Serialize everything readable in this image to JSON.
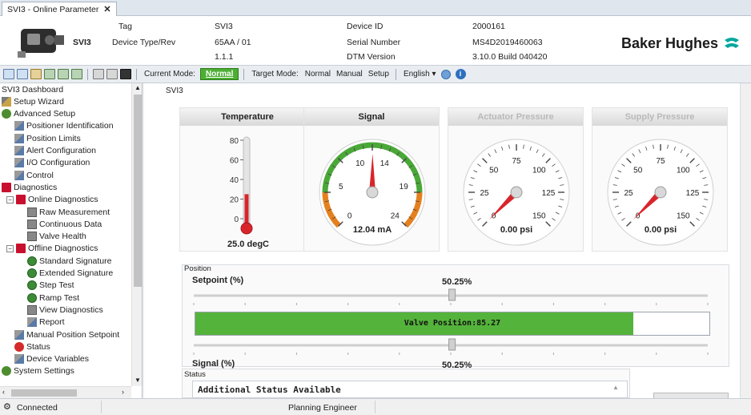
{
  "tab": {
    "label": "SVI3   - Online Parameter",
    "close": "✕"
  },
  "device": {
    "model": "SVI3",
    "tag_label": "Tag",
    "tag_value": "SVI3",
    "type_label": "Device Type/Rev",
    "type_value": "65AA / 01",
    "rev_value": "1.1.1",
    "id_label": "Device ID",
    "id_value": "2000161",
    "serial_label": "Serial Number",
    "serial_value": "MS4D2019460063",
    "dtm_label": "DTM Version",
    "dtm_value": "3.10.0 Build 040420",
    "brand": "Baker Hughes",
    "brand_color": "#00a79d"
  },
  "toolbar": {
    "current_mode_label": "Current Mode:",
    "current_mode_value": "Normal",
    "target_mode_label": "Target Mode:",
    "modes": [
      "Normal",
      "Manual",
      "Setup"
    ],
    "language": "English"
  },
  "tree": {
    "items": [
      {
        "label": "SVI3 Dashboard",
        "icon": "none"
      },
      {
        "label": "Setup Wizard",
        "icon": "wand"
      },
      {
        "label": "Advanced Setup",
        "icon": "gear"
      },
      {
        "label": "Positioner Identification",
        "icon": "pen"
      },
      {
        "label": "Position Limits",
        "icon": "pen"
      },
      {
        "label": "Alert Configuration",
        "icon": "pen"
      },
      {
        "label": "I/O Configuration",
        "icon": "pen"
      },
      {
        "label": "Control",
        "icon": "pen"
      },
      {
        "label": "Diagnostics",
        "icon": "folder"
      },
      {
        "label": "Online Diagnostics",
        "icon": "folder"
      },
      {
        "label": "Raw Measurement",
        "icon": "doc"
      },
      {
        "label": "Continuous Data",
        "icon": "doc"
      },
      {
        "label": "Valve Health",
        "icon": "doc"
      },
      {
        "label": "Offline Diagnostics",
        "icon": "folder"
      },
      {
        "label": "Standard Signature",
        "icon": "green"
      },
      {
        "label": "Extended Signature",
        "icon": "green"
      },
      {
        "label": "Step Test",
        "icon": "green"
      },
      {
        "label": "Ramp Test",
        "icon": "green"
      },
      {
        "label": "View Diagnostics",
        "icon": "doc"
      },
      {
        "label": "Report",
        "icon": "pen"
      },
      {
        "label": "Manual Position Setpoint",
        "icon": "pen"
      },
      {
        "label": "Status",
        "icon": "red"
      },
      {
        "label": "Device Variables",
        "icon": "pen"
      },
      {
        "label": "System Settings",
        "icon": "gear"
      }
    ]
  },
  "main": {
    "panel_label": "SVI3",
    "temperature": {
      "title": "Temperature",
      "value": 25.0,
      "readout": "25.0 degC",
      "ticks": [
        "80",
        "60",
        "40",
        "20",
        "0"
      ],
      "max": 80
    },
    "signal": {
      "title": "Signal",
      "value": 12.04,
      "readout": "12.04 mA",
      "ticks": [
        "0",
        "5",
        "10",
        "14",
        "19",
        "24"
      ],
      "min": 0,
      "max": 24
    },
    "actuator": {
      "title": "Actuator Pressure",
      "value": 0,
      "readout": "0.00 psi",
      "ticks": [
        "0",
        "25",
        "50",
        "75",
        "100",
        "125",
        "150"
      ],
      "max": 150
    },
    "supply": {
      "title": "Supply Pressure",
      "value": 0,
      "readout": "0.00 psi",
      "ticks": [
        "0",
        "25",
        "50",
        "75",
        "100",
        "125",
        "150"
      ],
      "max": 150
    },
    "position": {
      "section_label": "Position",
      "setpoint_label": "Setpoint (%)",
      "setpoint_value": "50.25%",
      "setpoint_fraction": 0.5025,
      "valve_text": "Valve Position:85.27",
      "valve_fraction": 0.8527,
      "signal_label": "Signal (%)",
      "signal_value": "50.25%",
      "signal_fraction": 0.5025
    },
    "status": {
      "section_label": "Status",
      "text": "Additional Status Available"
    }
  },
  "statusbar": {
    "connection": "Connected",
    "role": "Planning Engineer"
  },
  "colors": {
    "accent_green": "#4caf34",
    "needle_red": "#d8252b",
    "gauge_orange": "#e5801f",
    "gauge_green": "#4aa838"
  }
}
